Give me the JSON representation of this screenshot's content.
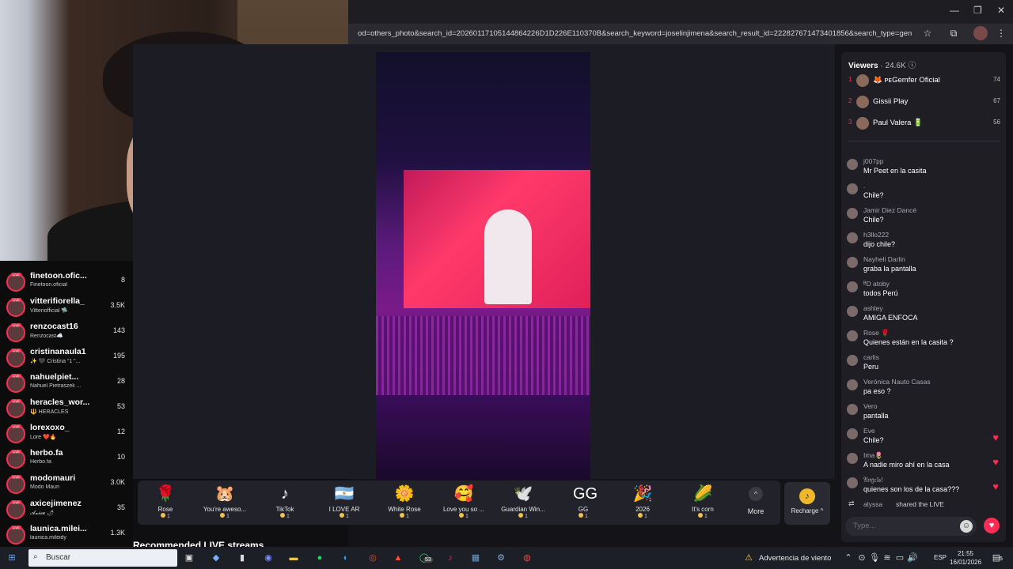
{
  "browser": {
    "url": "od=others_photo&search_id=20260117105144864226D1D226E110370B&search_keyword=joselinjimena&search_result_id=222827671473401856&search_type=general",
    "window_controls": [
      "—",
      "❐",
      "✕"
    ]
  },
  "left_list": [
    {
      "name": "finetoon.ofic...",
      "sub": "Finetoon.oficial",
      "count": "8"
    },
    {
      "name": "vitterifiorella_",
      "sub": "Vitteriofficial 🛸",
      "count": "3.5K"
    },
    {
      "name": "renzocast16",
      "sub": "Renzocast☁️",
      "count": "143"
    },
    {
      "name": "cristinanaula1",
      "sub": "✨ 🖤 Cristina “1 ”...",
      "count": "195"
    },
    {
      "name": "nahuelpiet...",
      "sub": "Nahuel Pietraszek ...",
      "count": "28"
    },
    {
      "name": "heracles_wor...",
      "sub": "🔱 HERACLES",
      "count": "53"
    },
    {
      "name": "lorexoxo_",
      "sub": "Lore ❤️🔥",
      "count": "12"
    },
    {
      "name": "herbo.fa",
      "sub": "Herbo.fa",
      "count": "10"
    },
    {
      "name": "modomauri",
      "sub": "Modo Mauri",
      "count": "3.0K"
    },
    {
      "name": "axicejimenez",
      "sub": "𝓐𝔁𝓲𝓬𝓮 🌶",
      "count": "35"
    },
    {
      "name": "launica.milei...",
      "sub": "launica.mileidy",
      "count": "1.3K"
    }
  ],
  "live_tag": "LIVE",
  "gifts": [
    {
      "name": "Rose",
      "icon": "🌹",
      "cost": "1"
    },
    {
      "name": "You're aweso...",
      "icon": "🐹",
      "cost": "1"
    },
    {
      "name": "TikTok",
      "icon": "♪",
      "cost": "1"
    },
    {
      "name": "I LOVE AR",
      "icon": "🇦🇷",
      "cost": "1"
    },
    {
      "name": "White Rose",
      "icon": "🌼",
      "cost": "1"
    },
    {
      "name": "Love you so ...",
      "icon": "🥰",
      "cost": "1"
    },
    {
      "name": "Guardian Win...",
      "icon": "🕊️",
      "cost": "1"
    },
    {
      "name": "GG",
      "icon": "GG",
      "cost": "1"
    },
    {
      "name": "2026",
      "icon": "🎉",
      "cost": "1"
    },
    {
      "name": "It's corn",
      "icon": "🌽",
      "cost": "1"
    }
  ],
  "more_label": "More",
  "recharge_label": "Recharge ^",
  "recommended_label": "Recommended LIVE streams",
  "viewers": {
    "label": "Viewers",
    "count": "· 24.6K",
    "top": [
      {
        "rank": "1",
        "name": "🦊 ᴘᴇGemfer Oficial",
        "score": "74"
      },
      {
        "rank": "2",
        "name": "Gissii   Play",
        "score": "67"
      },
      {
        "rank": "3",
        "name": "Paul Valera 🔋",
        "score": "56"
      }
    ]
  },
  "chat": [
    {
      "user": "j007pp",
      "text": "Mr Peet en la casita",
      "heart": false
    },
    {
      "user": ".",
      "text": "Chile?",
      "heart": false
    },
    {
      "user": "Jamir Diez Dancé",
      "text": "Chile?",
      "heart": false
    },
    {
      "user": "h3llo222",
      "text": "dijo chile?",
      "heart": false
    },
    {
      "user": "Nayheli Darlin",
      "text": "graba la pantalla",
      "heart": false
    },
    {
      "user": "ᴮD atoby",
      "text": "todos Perú",
      "heart": false
    },
    {
      "user": "ashley",
      "text": "AMIGA ENFOCA",
      "heart": false
    },
    {
      "user": "Rose 🌹",
      "text": "Quienes están en la casita ?",
      "heart": false
    },
    {
      "user": "carlis",
      "text": "Peru",
      "heart": false
    },
    {
      "user": "Verónica Nauto Casas",
      "text": "pa eso ?",
      "heart": false
    },
    {
      "user": "Vero",
      "text": "pantalla",
      "heart": false
    },
    {
      "user": "Eve",
      "text": "Chile?",
      "heart": true
    },
    {
      "user": "Ima🌷",
      "text": "A nadie miro ahí en la casa",
      "heart": true
    },
    {
      "user": "𝔄𝔫𝔤𝔢𝔩𝔰!",
      "text": "quienes son los de la casa???",
      "heart": true
    }
  ],
  "share": {
    "user": "alyssa",
    "text": "shared the LIVE"
  },
  "input_placeholder": "Type...",
  "taskbar": {
    "search_label": "Buscar",
    "weather": "Advertencia de viento",
    "lang": "ESP",
    "time": "21:55",
    "date": "16/01/2026",
    "badge": "53",
    "notif": "5"
  },
  "colors": {
    "accent": "#fe2c55",
    "coin": "#f2c14e"
  }
}
